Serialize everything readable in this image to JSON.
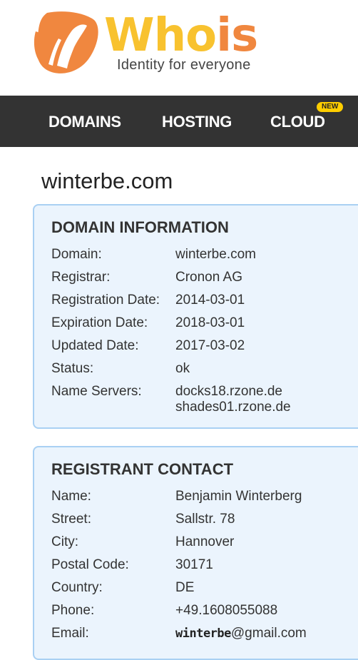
{
  "logo": {
    "word_part1": "Who",
    "word_part2": "is",
    "tagline": "Identity for everyone",
    "icon": "whois-hand-logo-icon",
    "colors": {
      "orange": "#f0873f",
      "yellow": "#f8c22f"
    }
  },
  "nav": {
    "items": [
      {
        "label": "DOMAINS"
      },
      {
        "label": "HOSTING"
      },
      {
        "label": "CLOUD"
      }
    ],
    "badge": "NEW",
    "background": "#333333",
    "badge_color": "#ffce00"
  },
  "page": {
    "title": "winterbe.com"
  },
  "domain_info": {
    "heading": "DOMAIN INFORMATION",
    "rows": [
      {
        "label": "Domain:",
        "value": "winterbe.com"
      },
      {
        "label": "Registrar:",
        "value": "Cronon AG"
      },
      {
        "label": "Registration Date:",
        "value": "2014-03-01"
      },
      {
        "label": "Expiration Date:",
        "value": "2018-03-01"
      },
      {
        "label": "Updated Date:",
        "value": "2017-03-02"
      },
      {
        "label": "Status:",
        "value": "ok"
      },
      {
        "label": "Name Servers:",
        "values": [
          "docks18.rzone.de",
          "shades01.rzone.de"
        ]
      }
    ]
  },
  "registrant": {
    "heading": "REGISTRANT CONTACT",
    "rows": [
      {
        "label": "Name:",
        "value": "Benjamin Winterberg"
      },
      {
        "label": "Street:",
        "value": "Sallstr. 78"
      },
      {
        "label": "City:",
        "value": "Hannover"
      },
      {
        "label": "Postal Code:",
        "value": "30171"
      },
      {
        "label": "Country:",
        "value": "DE"
      },
      {
        "label": "Phone:",
        "value": "+49.1608055088"
      },
      {
        "label": "Email:",
        "value_image_text": "winterbe",
        "value_suffix": "@gmail.com"
      }
    ]
  },
  "colors": {
    "card_bg": "#ebf4fd",
    "card_border": "#a9d0f3"
  }
}
